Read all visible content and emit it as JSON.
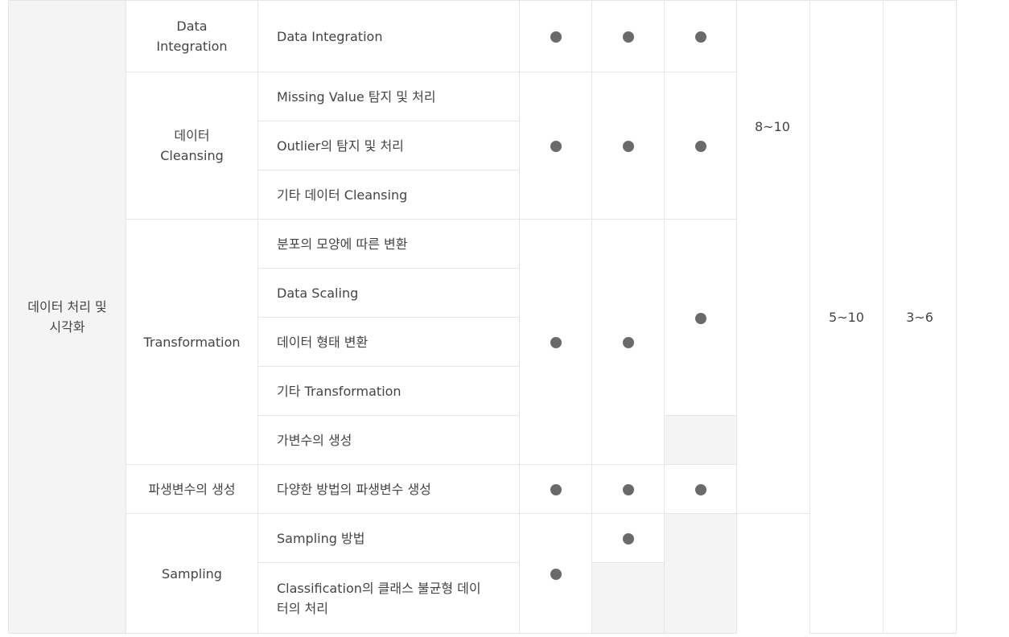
{
  "category": "데이터 처리 및 시각화",
  "groups": {
    "integration": "Data\nIntegration",
    "cleansing": "데이터\nCleansing",
    "transformation": "Transformation",
    "derived": "파생변수의 생성",
    "sampling": "Sampling"
  },
  "items": [
    "Data Integration",
    "Missing Value 탐지 및 처리",
    "Outlier의 탐지 및 처리",
    "기타 데이터 Cleansing",
    "분포의 모양에 따른 변환",
    "Data Scaling",
    "데이터 형태 변환",
    "기타 Transformation",
    "가변수의 생성",
    "다양한 방법의 파생변수 생성",
    "Sampling 방법",
    "Classification의 클래스 불균형 데이터의 처리"
  ],
  "ranges": {
    "hours": "8~10",
    "range_a": "5~10",
    "range_b": "3~6"
  },
  "colors": {
    "dot": "#6a6a6a",
    "category_bg": "#f4f4f4",
    "border": "#e6e6e6",
    "text": "#444444"
  }
}
